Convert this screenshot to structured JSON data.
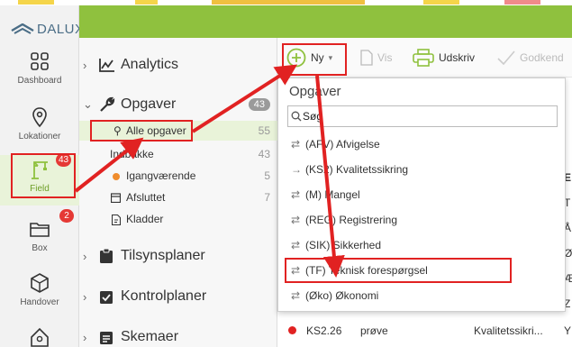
{
  "app": {
    "logo_text": "DALUX"
  },
  "rail": {
    "items": [
      {
        "label": "Dashboard"
      },
      {
        "label": "Lokationer"
      },
      {
        "label": "Field",
        "badge": "43"
      },
      {
        "label": "Box",
        "badge": "2"
      },
      {
        "label": "Handover"
      }
    ]
  },
  "nav": {
    "analytics": "Analytics",
    "opgaver": "Opgaver",
    "opgaver_count": "43",
    "sub": [
      {
        "label": "Alle opgaver",
        "count": "55"
      },
      {
        "label": "Indbakke",
        "count": "43"
      },
      {
        "label": "Igangværende",
        "count": "5"
      },
      {
        "label": "Afsluttet",
        "count": "7"
      },
      {
        "label": "Kladder",
        "count": ""
      }
    ],
    "tilsyn": "Tilsynsplaner",
    "kontrol": "Kontrolplaner",
    "skemaer": "Skemaer"
  },
  "toolbar": {
    "ny": "Ny",
    "vis": "Vis",
    "udskriv": "Udskriv",
    "godkend": "Godkend"
  },
  "dropdown": {
    "title": "Opgaver",
    "search_value": "Søg",
    "items": [
      {
        "arrow": "⇄",
        "label": "(AFV) Afvigelse"
      },
      {
        "arrow": "→",
        "label": "(KS2) Kvalitetssikring"
      },
      {
        "arrow": "⇄",
        "label": "(M) Mangel"
      },
      {
        "arrow": "⇄",
        "label": "(REG) Registrering"
      },
      {
        "arrow": "⇄",
        "label": "(SIK) Sikkerhed"
      },
      {
        "arrow": "⇄",
        "label": "(TF) Teknisk forespørgsel"
      },
      {
        "arrow": "⇄",
        "label": "(Øko) Økonomi"
      }
    ]
  },
  "table": {
    "side_letters": [
      "E",
      "T",
      "Å",
      "Ø",
      "Æ",
      "Z"
    ],
    "last_row": {
      "id": "KS2.26",
      "title": "prøve",
      "type": "Kvalitetssikri...",
      "extra": "Y"
    }
  },
  "colors": {
    "green": "#8fc13e",
    "red": "#e12222",
    "orange": "#f08c2c"
  }
}
